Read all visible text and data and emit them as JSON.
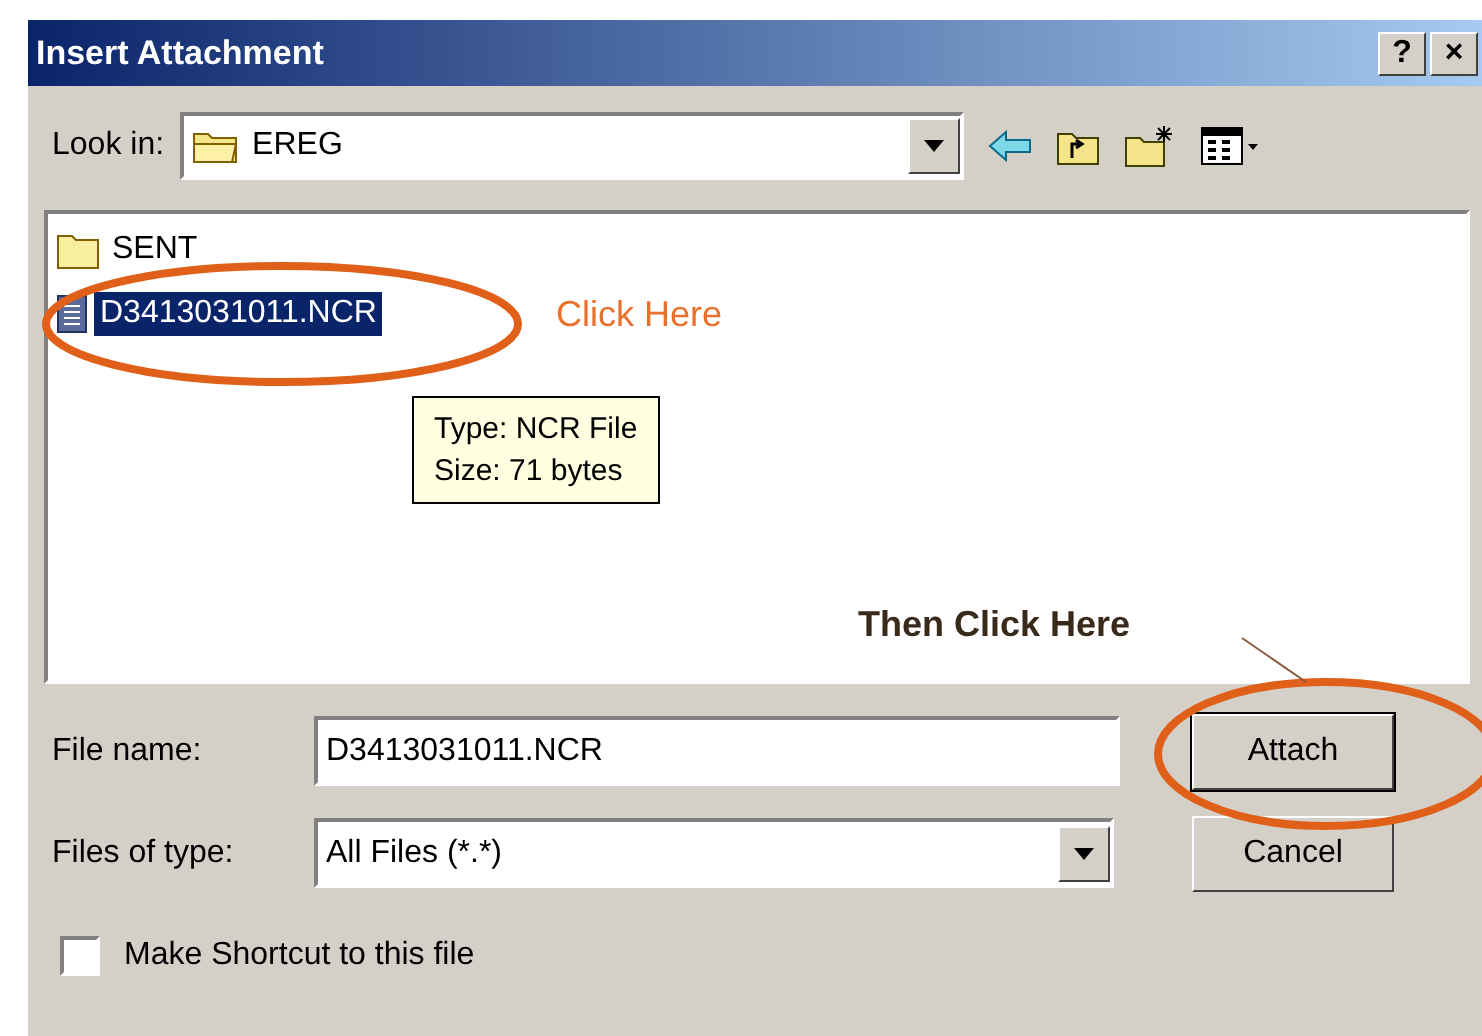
{
  "window": {
    "title": "Insert Attachment",
    "title_buttons": [
      "?",
      "×"
    ]
  },
  "look_in": {
    "label": "Look in:",
    "value": "EREG"
  },
  "files": [
    {
      "kind": "folder",
      "name": "SENT",
      "selected": false
    },
    {
      "kind": "file",
      "name": "D3413031011.NCR",
      "selected": true
    }
  ],
  "tooltip": [
    "Type: NCR File",
    "Size: 71 bytes"
  ],
  "file_name": {
    "label": "File name:",
    "value": "D3413031011.NCR"
  },
  "files_of_type": {
    "label": "Files of type:",
    "value": "All Files (*.*)"
  },
  "shortcut": {
    "label": "Make Shortcut to this file",
    "checked": false
  },
  "buttons": [
    "Attach",
    "Cancel"
  ],
  "annotations": [
    {
      "text": "Click Here",
      "color": "#e8702a"
    },
    {
      "text": "Then Click Here",
      "color": "#3a2a1a"
    }
  ]
}
